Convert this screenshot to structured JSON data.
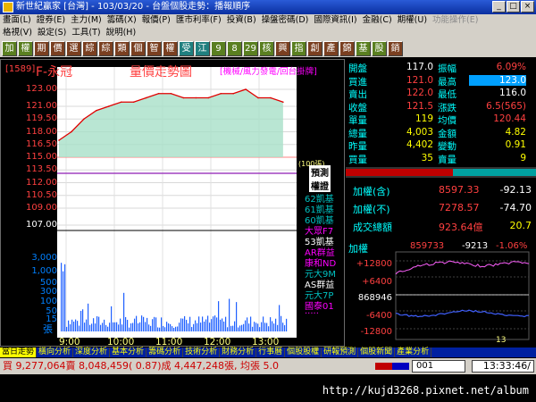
{
  "window": {
    "title": "新世紀贏家 [台灣] - 103/03/20 - 台盤個股走勢：播報順序",
    "buttons": [
      "_",
      "□",
      "×"
    ]
  },
  "menu1": [
    "畫面(L)",
    "證券(E)",
    "主力(M)",
    "籌碼(X)",
    "報價(P)",
    "匯市利率(F)",
    "投資(B)",
    "操盤密碼(D)",
    "國際資訊(I)",
    "金融(C)",
    "期權(U)",
    "功能操作(E)"
  ],
  "menu2": [
    "格視(V)",
    "設定(S)",
    "工具(T)",
    "說明(H)"
  ],
  "toolbar": {
    "items": [
      "加",
      "權",
      "期",
      "價",
      "選",
      "綜",
      "綜",
      "類",
      "個",
      "智",
      "權",
      "受",
      "江",
      "9",
      "8",
      "29",
      "核",
      "興",
      "指",
      "創",
      "產",
      "錦",
      "基",
      "股",
      "銷"
    ],
    "colors": [
      "#5a7f20",
      "#5a7f20",
      "#7a3f20",
      "#7a3f20",
      "#7a3f20",
      "#7a3f20",
      "#7a3f20",
      "#7a3f20",
      "#7a3f20",
      "#7a3f20",
      "#7a3f20",
      "#207f7f",
      "#207f7f",
      "#5a7f20",
      "#5a7f20",
      "#5a7f20",
      "#5a7f20",
      "#7a3f20",
      "#5a7f20",
      "#7a3f20",
      "#7a3f20",
      "#7a3f20",
      "#5a7f20",
      "#5a7f20",
      "#7a3f20"
    ]
  },
  "stock": {
    "code": "[1589]",
    "name": "F-永冠",
    "chart_name": "量價走勢圖",
    "view_mode": "[機械/風力發電/回台掛牌]"
  },
  "price_axis": [
    "123.00",
    "121.00",
    "119.50",
    "118.00",
    "116.50",
    "115.00",
    "113.50",
    "112.00",
    "110.50",
    "109.00",
    "107.00"
  ],
  "volume_axis": [
    "3,000",
    "1,000",
    "500",
    "300",
    "100",
    "50",
    "15"
  ],
  "volume_unit": "張",
  "volume_ref": "(100張)",
  "time_axis": [
    "9:00",
    "10:00",
    "11:00",
    "12:00",
    "13:00"
  ],
  "side_list": [
    {
      "label": "預測",
      "color": "#000000"
    },
    {
      "label": "權證",
      "color": "#000000"
    },
    {
      "label": "62凱基",
      "color": "#00c0c0"
    },
    {
      "label": "61凱基",
      "color": "#00c0c0"
    },
    {
      "label": "60凱基",
      "color": "#00c0c0"
    },
    {
      "label": "大眾F7",
      "color": "#ff00ff"
    },
    {
      "label": "53凱基",
      "color": "#ffffff"
    },
    {
      "label": "AR群益",
      "color": "#ff00ff"
    },
    {
      "label": "康和ND",
      "color": "#ff00ff"
    },
    {
      "label": "元大9M",
      "color": "#00c0c0"
    },
    {
      "label": "AS群益",
      "color": "#ffffff"
    },
    {
      "label": "元大7P",
      "color": "#00c0c0"
    },
    {
      "label": "國泰01",
      "color": "#ff00ff"
    },
    {
      "label": "·····",
      "color": "#ff00ff"
    }
  ],
  "quote": {
    "rows": [
      {
        "l1": "開盤",
        "v1": "117.0",
        "c1": "#ffffff",
        "l2": "振幅",
        "v2": "6.09%",
        "c2": "#ff4040"
      },
      {
        "l1": "買進",
        "v1": "121.0",
        "c1": "#ff4040",
        "l2": "最高",
        "v2": "123.0",
        "c2": "#ffffff",
        "hl2": true
      },
      {
        "l1": "賣出",
        "v1": "122.0",
        "c1": "#ff4040",
        "l2": "最低",
        "v2": "116.0",
        "c2": "#ffffff"
      },
      {
        "l1": "收盤",
        "v1": "121.5",
        "c1": "#ff4040",
        "l2": "漲跌",
        "v2": "6.5(565)",
        "c2": "#ff4040"
      },
      {
        "l1": "單量",
        "v1": "119",
        "c1": "#ffff00",
        "l2": "均價",
        "v2": "120.44",
        "c2": "#ff4040"
      },
      {
        "l1": "總量",
        "v1": "4,003",
        "c1": "#ffff00",
        "l2": "金額",
        "v2": "4.82",
        "c2": "#ffff00"
      },
      {
        "l1": "昨量",
        "v1": "4,402",
        "c1": "#ffff00",
        "l2": "變動",
        "v2": "0.91",
        "c2": "#ffff00"
      },
      {
        "l1": "買量",
        "v1": "35",
        "c1": "#ffff00",
        "l2": "賣量",
        "v2": "9",
        "c2": "#ffff00"
      }
    ]
  },
  "index_rows": [
    {
      "label": "加權(含)",
      "value": "8597.33",
      "change": "-92.13",
      "vc": "#ff4040",
      "cc": "#ffffff"
    },
    {
      "label": "加權(不)",
      "value": "7278.57",
      "change": "-74.70",
      "vc": "#ff4040",
      "cc": "#ffffff"
    },
    {
      "label": "成交總額",
      "value": "923.64億",
      "change": "20.7",
      "vc": "#ff4040",
      "cc": "#ffff00"
    }
  ],
  "mini": {
    "title": "加權",
    "value": "859733",
    "change": "-9213",
    "pct": "-1.06%",
    "axis": [
      "+12800",
      "+6400",
      "868946",
      "-6400",
      "-12800"
    ],
    "hour": "13"
  },
  "tabs": [
    "當日走勢",
    "橫向分析",
    "深度分析",
    "基本分析",
    "籌碼分析",
    "技術分析",
    "財務分析",
    "行事曆",
    "個股股權",
    "研報預測",
    "個股新聞",
    "產業分析"
  ],
  "status": {
    "ticker": "買 9,277,064賣 8,048,459( 0.87)成 4,447,248張, 均張 5.0",
    "slot": "001",
    "clock": "13:33:46/"
  },
  "watermark": "http://kujd3268.pixnet.net/album",
  "chart_data": {
    "type": "line",
    "x": [
      "9:00",
      "9:15",
      "9:30",
      "9:45",
      "10:00",
      "10:15",
      "10:30",
      "10:45",
      "11:00",
      "11:15",
      "11:30",
      "11:45",
      "12:00",
      "12:15",
      "12:30",
      "12:45",
      "13:00",
      "13:15",
      "13:30"
    ],
    "series": [
      {
        "values": [
          117.0,
          118.0,
          119.5,
          120.5,
          121.0,
          121.5,
          121.5,
          122.0,
          122.5,
          122.5,
          122.0,
          122.0,
          122.0,
          122.5,
          122.5,
          123.0,
          122.0,
          122.0,
          121.5
        ]
      }
    ],
    "ylim": [
      107.0,
      123.0
    ],
    "reference": 115.0
  }
}
